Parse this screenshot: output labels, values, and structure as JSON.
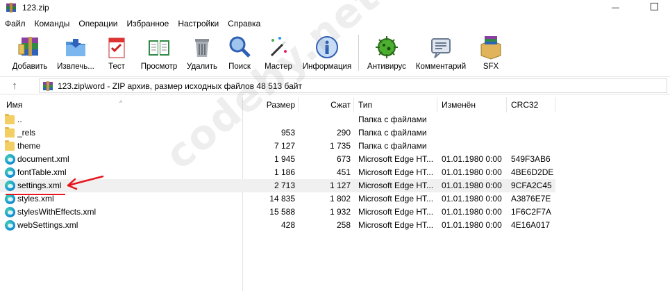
{
  "window": {
    "title": "123.zip"
  },
  "menu": [
    "Файл",
    "Команды",
    "Операции",
    "Избранное",
    "Настройки",
    "Справка"
  ],
  "toolbar": {
    "buttons": [
      {
        "label": "Добавить",
        "icon": "add-archive-icon"
      },
      {
        "label": "Извлечь...",
        "icon": "extract-icon"
      },
      {
        "label": "Тест",
        "icon": "test-icon"
      },
      {
        "label": "Просмотр",
        "icon": "view-icon"
      },
      {
        "label": "Удалить",
        "icon": "delete-icon"
      },
      {
        "label": "Поиск",
        "icon": "find-icon"
      },
      {
        "label": "Мастер",
        "icon": "wizard-icon"
      },
      {
        "label": "Информация",
        "icon": "info-icon"
      },
      {
        "label": "Антивирус",
        "icon": "antivirus-icon"
      },
      {
        "label": "Комментарий",
        "icon": "comment-icon"
      },
      {
        "label": "SFX",
        "icon": "sfx-icon"
      }
    ]
  },
  "address": {
    "path": "123.zip\\word - ZIP архив, размер исходных файлов 48 513 байт"
  },
  "columns": {
    "name": "Имя",
    "size": "Размер",
    "packed": "Сжат",
    "type": "Тип",
    "modified": "Изменён",
    "crc": "CRC32"
  },
  "files": [
    {
      "name": "..",
      "size": "",
      "packed": "",
      "type": "Папка с файлами",
      "modified": "",
      "crc": "",
      "kind": "folder"
    },
    {
      "name": "_rels",
      "size": "953",
      "packed": "290",
      "type": "Папка с файлами",
      "modified": "",
      "crc": "",
      "kind": "folder"
    },
    {
      "name": "theme",
      "size": "7 127",
      "packed": "1 735",
      "type": "Папка с файлами",
      "modified": "",
      "crc": "",
      "kind": "folder"
    },
    {
      "name": "document.xml",
      "size": "1 945",
      "packed": "673",
      "type": "Microsoft Edge HT...",
      "modified": "01.01.1980 0:00",
      "crc": "549F3AB6",
      "kind": "edge"
    },
    {
      "name": "fontTable.xml",
      "size": "1 186",
      "packed": "451",
      "type": "Microsoft Edge HT...",
      "modified": "01.01.1980 0:00",
      "crc": "4BE6D2DE",
      "kind": "edge"
    },
    {
      "name": "settings.xml",
      "size": "2 713",
      "packed": "1 127",
      "type": "Microsoft Edge HT...",
      "modified": "01.01.1980 0:00",
      "crc": "9CFA2C45",
      "kind": "edge"
    },
    {
      "name": "styles.xml",
      "size": "14 835",
      "packed": "1 802",
      "type": "Microsoft Edge HT...",
      "modified": "01.01.1980 0:00",
      "crc": "A3876E7E",
      "kind": "edge"
    },
    {
      "name": "stylesWithEffects.xml",
      "size": "15 588",
      "packed": "1 932",
      "type": "Microsoft Edge HT...",
      "modified": "01.01.1980 0:00",
      "crc": "1F6C2F7A",
      "kind": "edge"
    },
    {
      "name": "webSettings.xml",
      "size": "428",
      "packed": "258",
      "type": "Microsoft Edge HT...",
      "modified": "01.01.1980 0:00",
      "crc": "4E16A017",
      "kind": "edge"
    }
  ],
  "watermark": "codeby.net",
  "colors": {
    "annotation": "#e8141b",
    "selected_row": "#f0f0f0"
  }
}
